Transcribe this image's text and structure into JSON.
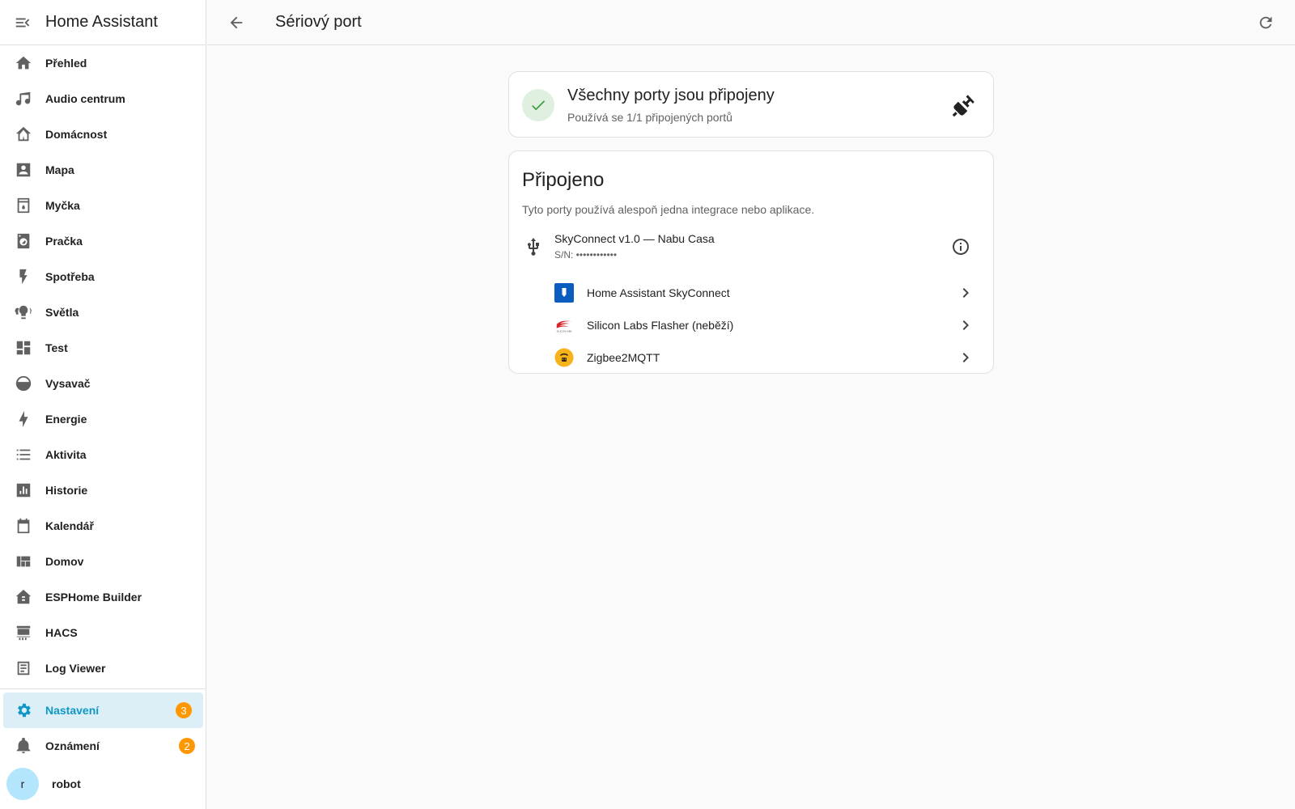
{
  "app": {
    "title": "Home Assistant"
  },
  "sidebar": {
    "items": [
      {
        "label": "Přehled",
        "icon": "home-icon"
      },
      {
        "label": "Audio centrum",
        "icon": "music-note-icon"
      },
      {
        "label": "Domácnost",
        "icon": "home-outline-icon"
      },
      {
        "label": "Mapa",
        "icon": "account-box-icon"
      },
      {
        "label": "Myčka",
        "icon": "dishwasher-icon"
      },
      {
        "label": "Pračka",
        "icon": "washing-machine-icon"
      },
      {
        "label": "Spotřeba",
        "icon": "flash-icon"
      },
      {
        "label": "Světla",
        "icon": "lightbulb-group-icon"
      },
      {
        "label": "Test",
        "icon": "view-dashboard-icon"
      },
      {
        "label": "Vysavač",
        "icon": "robot-vacuum-icon"
      },
      {
        "label": "Energie",
        "icon": "lightning-bolt-icon"
      },
      {
        "label": "Aktivita",
        "icon": "format-list-bulleted-icon"
      },
      {
        "label": "Historie",
        "icon": "chart-box-icon"
      },
      {
        "label": "Kalendář",
        "icon": "calendar-icon"
      },
      {
        "label": "Domov",
        "icon": "view-quilt-icon"
      },
      {
        "label": "ESPHome Builder",
        "icon": "esphome-icon"
      },
      {
        "label": "HACS",
        "icon": "hacs-icon"
      },
      {
        "label": "Log Viewer",
        "icon": "text-box-icon"
      }
    ],
    "settings": {
      "label": "Nastavení",
      "badge": "3"
    },
    "notifications": {
      "label": "Oznámení",
      "badge": "2"
    },
    "user": {
      "initial": "r",
      "name": "robot"
    }
  },
  "header": {
    "title": "Sériový port"
  },
  "status": {
    "title": "Všechny porty jsou připojeny",
    "subtitle": "Používá se 1/1 připojených portů"
  },
  "connected": {
    "title": "Připojeno",
    "description": "Tyto porty používá alespoň jedna integrace nebo aplikace.",
    "device": {
      "name": "SkyConnect v1.0 — Nabu Casa",
      "serial": "S/N: ••••••••••••"
    },
    "integrations": [
      {
        "name": "Home Assistant SkyConnect",
        "icon": "skyconnect-icon"
      },
      {
        "name": "Silicon Labs Flasher (neběží)",
        "icon": "silicon-labs-icon"
      },
      {
        "name": "Zigbee2MQTT",
        "icon": "zigbee2mqtt-icon"
      }
    ]
  },
  "colors": {
    "accent": "#03a9f4",
    "badge": "#ff9800",
    "success": "#43a047",
    "active_bg": "#ddeff6"
  }
}
